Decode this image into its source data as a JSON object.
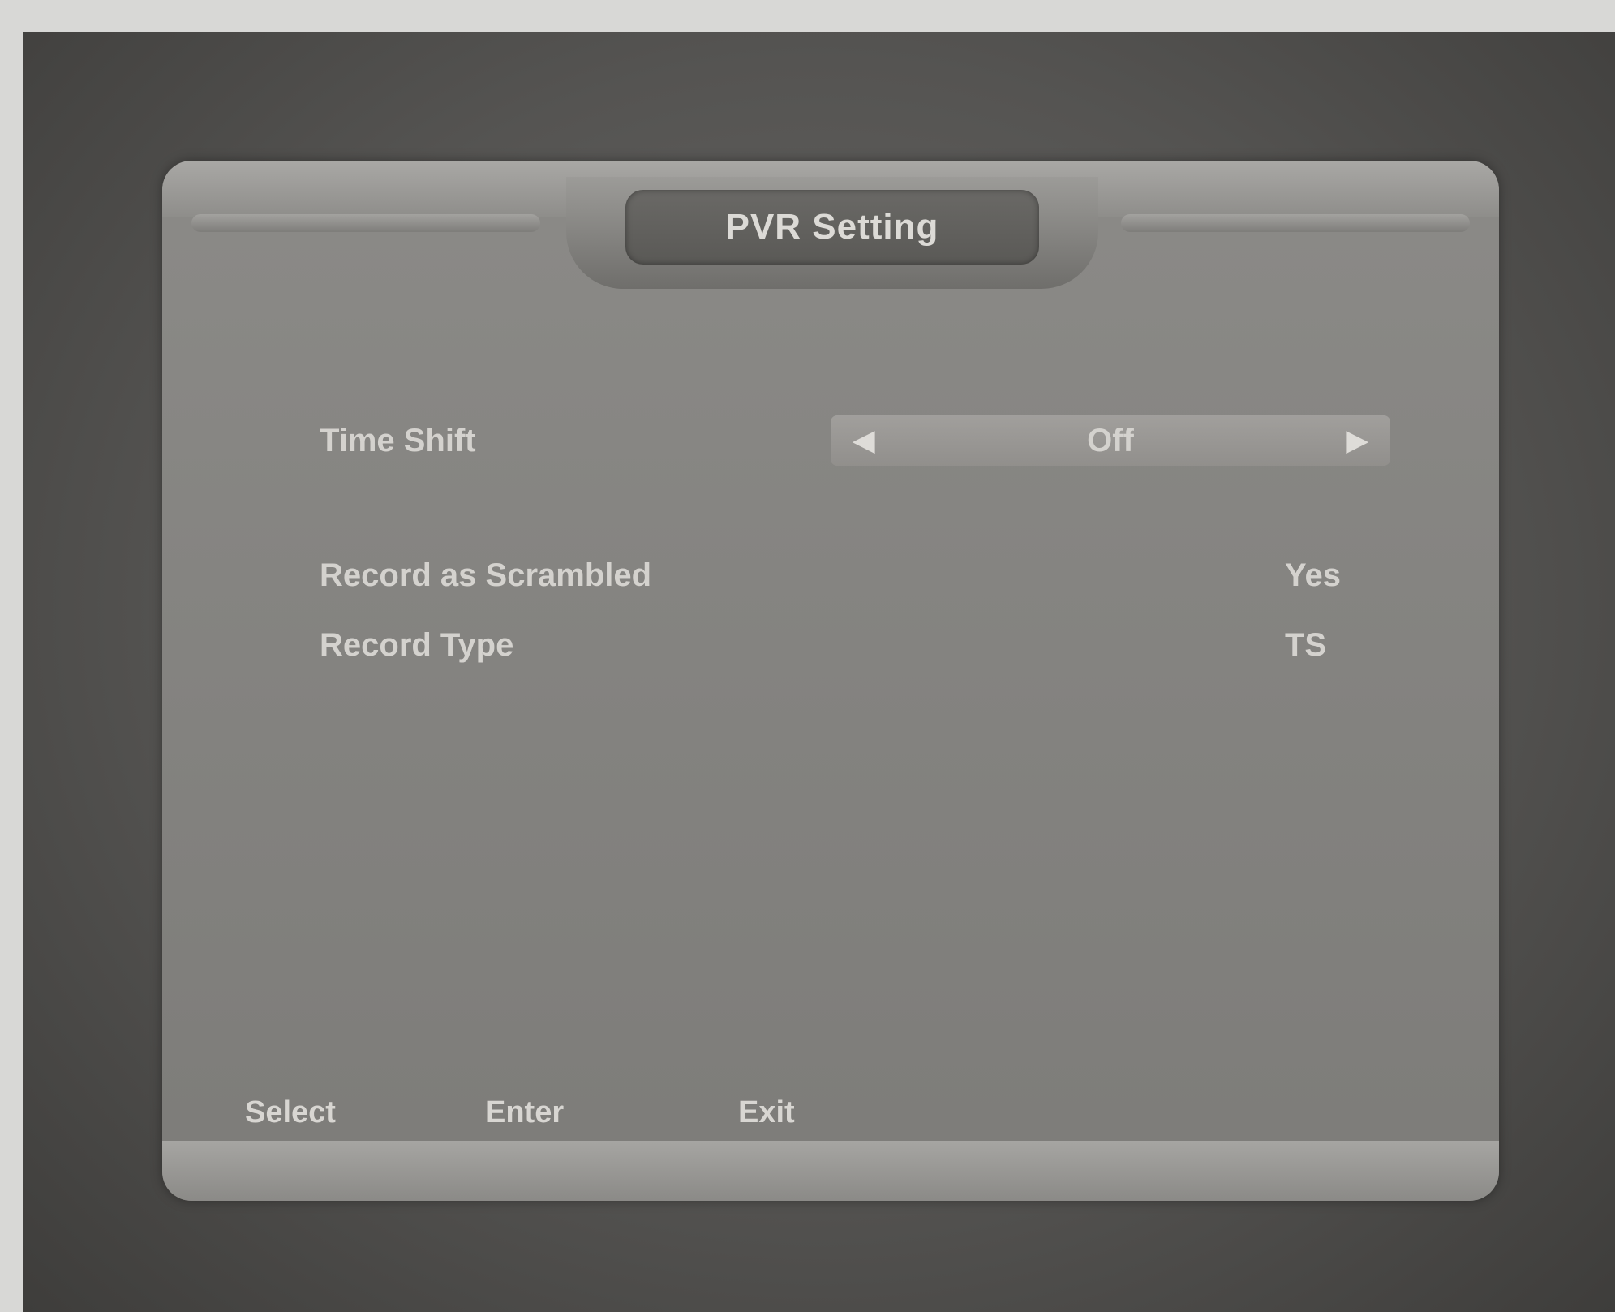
{
  "window": {
    "title": "PVR Setting"
  },
  "settings": [
    {
      "label": "Time Shift",
      "value": "Off"
    },
    {
      "label": "Record as Scrambled",
      "value": "Yes"
    },
    {
      "label": "Record Type",
      "value": "TS"
    }
  ],
  "footer": {
    "select_label": "Select",
    "enter_label": "Enter",
    "exit_label": "Exit"
  },
  "icons": {
    "left_arrow": "left-arrow-icon",
    "right_arrow": "right-arrow-icon"
  },
  "colors": {
    "panel": "#858481",
    "text": "#d4d2ce"
  }
}
